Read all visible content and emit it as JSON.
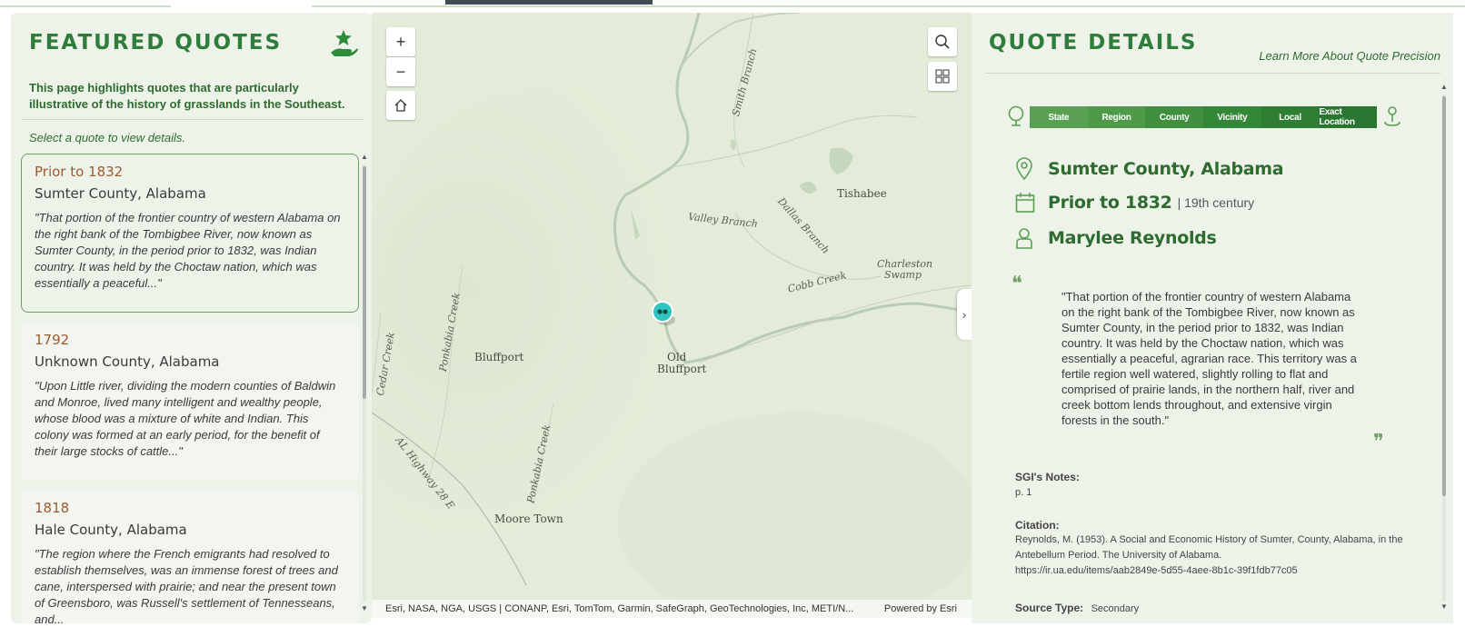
{
  "left": {
    "title": "FEATURED QUOTES",
    "intro": "This page highlights quotes that are particularly illustrative of the history of grasslands in the Southeast.",
    "hint": "Select a quote to view details.",
    "cards": [
      {
        "date": "Prior to 1832",
        "location": "Sumter County, Alabama",
        "quote": "\"That portion of the frontier country of western Alabama on the right bank of the Tombigbee River, now known as Sumter County, in the period prior to 1832, was Indian country. It was held by the Choctaw nation, which was essentially a peaceful...\""
      },
      {
        "date": "1792",
        "location": "Unknown County, Alabama",
        "quote": "\"Upon Little river, dividing the modern counties of Baldwin and Monroe, lived many intelligent and wealthy people, whose blood was a mixture of white and Indian. This colony was formed at an early period, for the benefit of their large stocks of cattle...\""
      },
      {
        "date": "1818",
        "location": "Hale County, Alabama",
        "quote": "\"The region where the French emigrants had resolved to establish themselves, was an immense forest of trees and cane, interspersed with prairie; and near the present town of Greensboro, was Russell's settlement of Tennesseans, and..."
      }
    ]
  },
  "map": {
    "zoom_in": "+",
    "zoom_out": "−",
    "attribution": "Esri, NASA, NGA, USGS | CONANP, Esri, TomTom, Garmin, SafeGraph, GeoTechnologies, Inc, METI/N...",
    "powered": "Powered by Esri",
    "labels": {
      "tishabee": "Tishabee",
      "valley_branch": "Valley Branch",
      "dallas_branch": "Dallas Branch",
      "smith_branch": "Smith Branch",
      "charleston_swamp_1": "Charleston",
      "charleston_swamp_2": "Swamp",
      "cobb_creek": "Cobb Creek",
      "bluffport": "Bluffport",
      "old_bluffport_1": "Old",
      "old_bluffport_2": "Bluffport",
      "ponkabia_creek_1": "Ponkabia Creek",
      "ponkabia_creek_2": "Ponkabia Creek",
      "cedar_creek": "Cedar Creek",
      "al_highway": "AL Highway 28 E",
      "moore_town": "Moore Town"
    }
  },
  "right": {
    "title": "QUOTE DETAILS",
    "learn_more": "Learn More About Quote Precision",
    "precision": [
      "State",
      "Region",
      "County",
      "Vicinity",
      "Local",
      "Exact Location"
    ],
    "precision_colors": [
      "#5aa052",
      "#4e9a48",
      "#3f8f3e",
      "#358738",
      "#2e7f33",
      "#2a7630"
    ],
    "location": "Sumter County, Alabama",
    "date": "Prior to 1832",
    "century": "| 19th century",
    "author": "Marylee Reynolds",
    "quote": "\"That portion of the frontier country of western Alabama on the right bank of the Tombigbee River, now known as Sumter County, in the period prior to 1832, was Indian country. It was held by the Choctaw nation, which was essentially a peaceful, agrarian race. This territory was a fertile region well watered, slightly rolling to flat and comprised of prairie lands, in the northern half, river and creek bottom lends throughout, and extensive virgin forests in the south.\"",
    "notes_heading": "SGI's Notes:",
    "notes": "p. 1",
    "citation_heading": "Citation:",
    "citation_1": "Reynolds, M. (1953). A Social and Economic History of Sumter, County, Alabama, in the Antebellum Period. The University of Alabama.",
    "citation_2": "https://ir.ua.edu/items/aab2849e-5d55-4aee-8b1c-39f1fdb77c05",
    "source_heading": "Source Type:",
    "source_value": "Secondary"
  }
}
